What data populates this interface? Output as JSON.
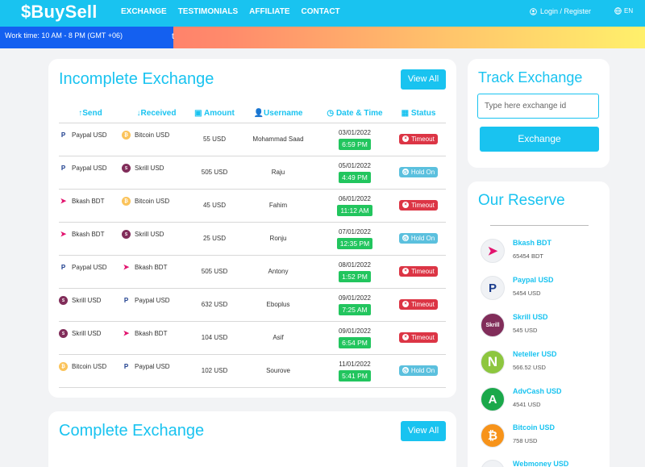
{
  "header": {
    "logo": "$BuySell",
    "nav": [
      "EXCHANGE",
      "TESTIMONIALS",
      "AFFILIATE",
      "CONTACT"
    ],
    "login": "Login / Register",
    "lang": "EN"
  },
  "ticker": {
    "label": "Work time: 10 AM - 8 PM (GMT +06)",
    "text": "t"
  },
  "incomplete": {
    "title": "Incomplete Exchange",
    "view_all": "View All",
    "headers": [
      "Send",
      "Received",
      "Amount",
      "Username",
      "Date & Time",
      "Status"
    ],
    "rows": [
      {
        "send": "Paypal USD",
        "send_icon": "paypal",
        "recv": "Bitcoin USD",
        "recv_icon": "bitcoin",
        "amount": "55 USD",
        "user": "Mohammad Saad",
        "date": "03/01/2022",
        "time": "6:59 PM",
        "status": "Timeout"
      },
      {
        "send": "Paypal USD",
        "send_icon": "paypal",
        "recv": "Skrill USD",
        "recv_icon": "skrill",
        "amount": "505 USD",
        "user": "Raju",
        "date": "05/01/2022",
        "time": "4:49 PM",
        "status": "Hold On"
      },
      {
        "send": "Bkash BDT",
        "send_icon": "bkash",
        "recv": "Bitcoin USD",
        "recv_icon": "bitcoin",
        "amount": "45 USD",
        "user": "Fahim",
        "date": "06/01/2022",
        "time": "11:12 AM",
        "status": "Timeout"
      },
      {
        "send": "Bkash BDT",
        "send_icon": "bkash",
        "recv": "Skrill USD",
        "recv_icon": "skrill",
        "amount": "25 USD",
        "user": "Ronju",
        "date": "07/01/2022",
        "time": "12:35 PM",
        "status": "Hold On"
      },
      {
        "send": "Paypal USD",
        "send_icon": "paypal",
        "recv": "Bkash BDT",
        "recv_icon": "bkash",
        "amount": "505 USD",
        "user": "Antony",
        "date": "08/01/2022",
        "time": "1:52 PM",
        "status": "Timeout"
      },
      {
        "send": "Skrill USD",
        "send_icon": "skrill",
        "recv": "Paypal USD",
        "recv_icon": "paypal",
        "amount": "632 USD",
        "user": "Eboplus",
        "date": "09/01/2022",
        "time": "7:25 AM",
        "status": "Timeout"
      },
      {
        "send": "Skrill USD",
        "send_icon": "skrill",
        "recv": "Bkash BDT",
        "recv_icon": "bkash",
        "amount": "104 USD",
        "user": "Asif",
        "date": "09/01/2022",
        "time": "6:54 PM",
        "status": "Timeout"
      },
      {
        "send": "Bitcoin USD",
        "send_icon": "bitcoin",
        "recv": "Paypal USD",
        "recv_icon": "paypal",
        "amount": "102 USD",
        "user": "Sourove",
        "date": "11/01/2022",
        "time": "5:41 PM",
        "status": "Hold On"
      }
    ]
  },
  "complete": {
    "title": "Complete Exchange",
    "view_all": "View All"
  },
  "track": {
    "title": "Track Exchange",
    "placeholder": "Type here exchange id",
    "button": "Exchange"
  },
  "reserve": {
    "title": "Our Reserve",
    "items": [
      {
        "name": "Bkash BDT",
        "amount": "65454 BDT",
        "icon": "bkash-icon"
      },
      {
        "name": "Paypal USD",
        "amount": "5454 USD",
        "icon": "paypal-icon"
      },
      {
        "name": "Skrill USD",
        "amount": "545 USD",
        "icon": "skrill-icon"
      },
      {
        "name": "Neteller USD",
        "amount": "566.52 USD",
        "icon": "neteller-icon"
      },
      {
        "name": "AdvCash USD",
        "amount": "4541 USD",
        "icon": "advcash-icon"
      },
      {
        "name": "Bitcoin USD",
        "amount": "758 USD",
        "icon": "bitcoin-icon"
      },
      {
        "name": "Webmoney USD",
        "amount": "",
        "icon": "webmoney-icon"
      }
    ]
  },
  "colors": {
    "accent": "#19c3f0",
    "timeout": "#dc3545",
    "hold": "#5bc0de",
    "time": "#22c55e"
  }
}
